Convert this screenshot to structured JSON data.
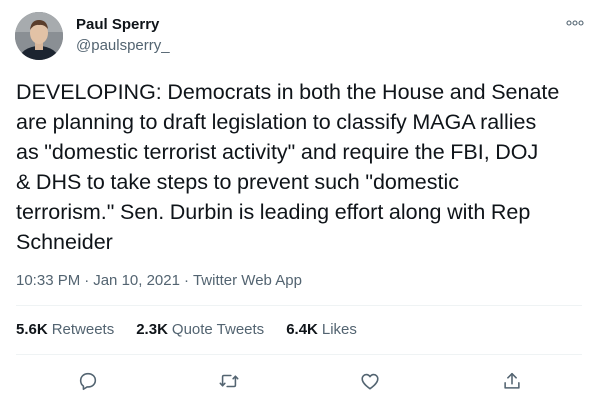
{
  "tweet": {
    "author_name": "Paul Sperry",
    "author_handle": "@paulsperry_",
    "text_lines": [
      "DEVELOPING: Democrats in both the House and Senate",
      "are planning to draft legislation to classify MAGA rallies",
      "as \"domestic terrorist activity\" and require the FBI, DOJ",
      "& DHS to take steps to prevent such \"domestic",
      "terrorism.\" Sen. Durbin is leading effort along with Rep",
      "Schneider"
    ],
    "time": "10:33 PM",
    "date": "Jan 10, 2021",
    "source": "Twitter Web App",
    "meta_separator": "·"
  },
  "stats": {
    "retweets_count": "5.6K",
    "retweets_label": "Retweets",
    "quotes_count": "2.3K",
    "quotes_label": "Quote Tweets",
    "likes_count": "6.4K",
    "likes_label": "Likes"
  },
  "icons": {
    "more": "more-dots-icon",
    "reply": "reply-icon",
    "retweet": "retweet-icon",
    "like": "heart-icon",
    "share": "share-icon"
  },
  "colors": {
    "text": "#0f1419",
    "secondary": "#536471",
    "divider": "#eff3f4"
  }
}
